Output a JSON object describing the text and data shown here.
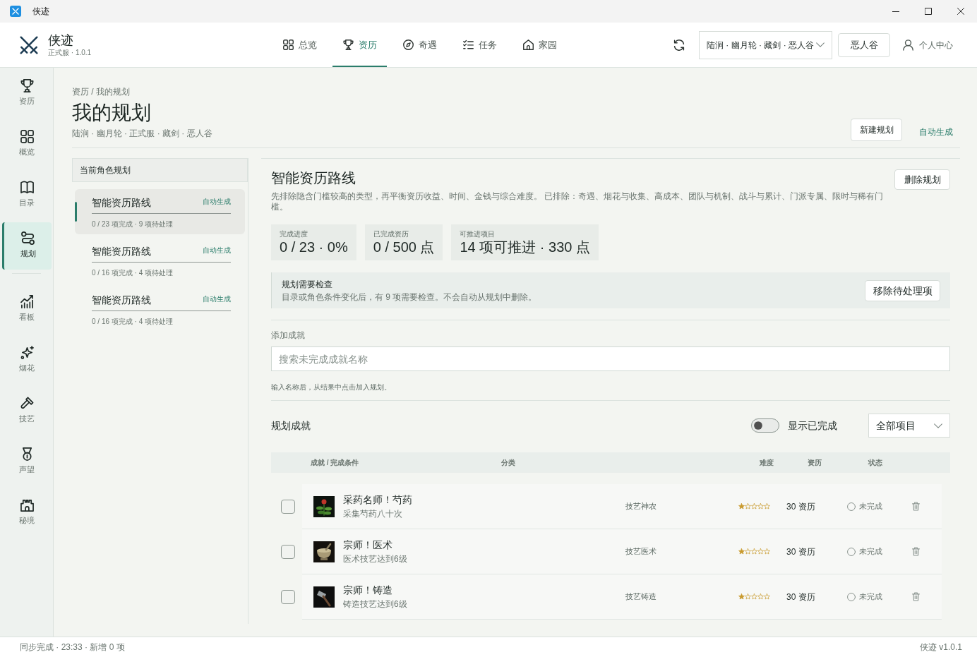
{
  "window": {
    "title": "侠迹"
  },
  "header": {
    "app_name": "侠迹",
    "edition": "正式服 · 1.0.1",
    "nav": [
      {
        "label": "总览",
        "selected": false
      },
      {
        "label": "资历",
        "selected": true
      },
      {
        "label": "奇遇",
        "selected": false
      },
      {
        "label": "任务",
        "selected": false
      },
      {
        "label": "家园",
        "selected": false
      }
    ],
    "character_select": {
      "value": "陆涧 · 幽月轮 · 藏剑 · 恶人谷"
    },
    "camp_button": "恶人谷",
    "profile_link": "个人中心"
  },
  "sidebar": {
    "groups": [
      {
        "items": [
          {
            "label": "资历",
            "selected": false
          },
          {
            "label": "概览",
            "selected": false
          },
          {
            "label": "目录",
            "selected": false
          },
          {
            "label": "规划",
            "selected": true
          }
        ]
      },
      {
        "items": [
          {
            "label": "看板",
            "selected": false
          },
          {
            "label": "烟花",
            "selected": false
          },
          {
            "label": "技艺",
            "selected": false
          },
          {
            "label": "声望",
            "selected": false
          },
          {
            "label": "秘境",
            "selected": false
          }
        ]
      }
    ]
  },
  "page": {
    "breadcrumb": "资历 / 我的规划",
    "title": "我的规划",
    "subtitle": "陆涧 · 幽月轮 · 正式服 · 藏剑 · 恶人谷",
    "new_button": "新建规划",
    "auto_link": "自动生成"
  },
  "plans_panel": {
    "title": "当前角色规划",
    "plans": [
      {
        "name": "智能资历路线",
        "tag": "自动生成",
        "summary": "0 / 23 项完成 · 9 项待处理",
        "selected": true
      },
      {
        "name": "智能资历路线",
        "tag": "自动生成",
        "summary": "0 / 16 项完成 · 4 项待处理",
        "selected": false
      },
      {
        "name": "智能资历路线",
        "tag": "自动生成",
        "summary": "0 / 16 项完成 · 4 项待处理",
        "selected": false
      }
    ]
  },
  "plan": {
    "title": "智能资历路线",
    "description": "先排除隐含门槛较高的类型，再平衡资历收益、时间、金钱与综合难度。 已排除：奇遇、烟花与收集、高成本、团队与机制、战斗与累计、门派专属、限时与稀有门槛。",
    "delete_button": "删除规划",
    "stats": [
      {
        "label": "完成进度",
        "value": "0 / 23 · 0%"
      },
      {
        "label": "已完成资历",
        "value": "0 / 500 点"
      },
      {
        "label": "可推进项目",
        "value": "14 项可推进 · 330 点"
      }
    ],
    "notice": {
      "title": "规划需要检查",
      "text": "目录或角色条件变化后，有 9 项需要检查。不会自动从规划中删除。",
      "button": "移除待处理项"
    },
    "add": {
      "label": "添加成就",
      "placeholder": "搜索未完成成就名称",
      "hint": "输入名称后，从结果中点击加入规划。"
    },
    "list": {
      "title": "规划成就",
      "show_completed": {
        "label": "显示已完成",
        "on": false
      },
      "filter": {
        "value": "全部项目"
      },
      "columns": [
        "成就 / 完成条件",
        "分类",
        "难度",
        "资历",
        "状态"
      ],
      "rows": [
        {
          "name": "采药名师！芍药",
          "condition": "采集芍药八十次",
          "category": "技艺神农",
          "stars": 1,
          "reward": "30 资历",
          "status": "未完成",
          "checked": false
        },
        {
          "name": "宗师！医术",
          "condition": "医术技艺达到6级",
          "category": "技艺医术",
          "stars": 1,
          "reward": "30 资历",
          "status": "未完成",
          "checked": false
        },
        {
          "name": "宗师！铸造",
          "condition": "铸造技艺达到6级",
          "category": "技艺铸造",
          "stars": 1,
          "reward": "30 资历",
          "status": "未完成",
          "checked": false
        }
      ]
    }
  },
  "status_bar": {
    "left": "同步完成 · 23:33 · 新增 0 项",
    "right": "侠迹 v1.0.1"
  }
}
